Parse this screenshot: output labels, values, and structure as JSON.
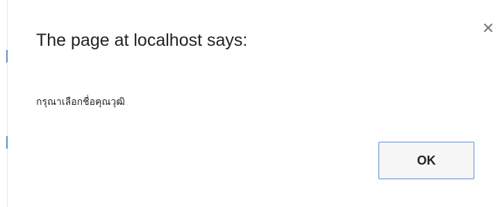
{
  "dialog": {
    "title": "The page at localhost says:",
    "message": "กรุณาเลือกชื่อคุณวุฒิ",
    "ok_label": "OK",
    "close_icon": "close-icon"
  },
  "colors": {
    "button_border": "#5b8fd6",
    "button_bg": "#f6f6f6",
    "text": "#222222",
    "close_icon": "#7a7a7a"
  }
}
